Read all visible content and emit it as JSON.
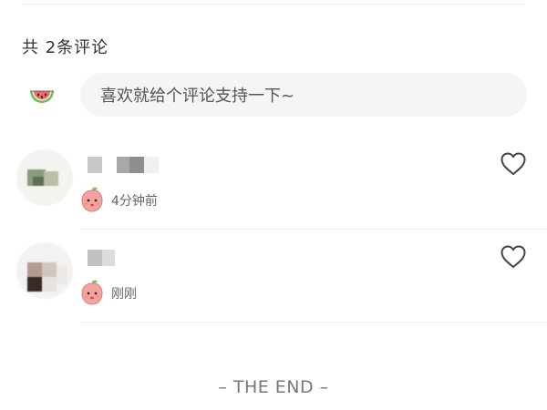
{
  "comments_header": {
    "count_text": "共 2条评论"
  },
  "input": {
    "avatar_icon": "watermelon-icon",
    "placeholder": "喜欢就给个评论支持一下~"
  },
  "comments": [
    {
      "name": "",
      "time": "4分钟前",
      "badge_icon": "peach-badge-icon",
      "like_icon": "heart-outline-icon"
    },
    {
      "name": "",
      "time": "刚刚",
      "badge_icon": "peach-badge-icon",
      "like_icon": "heart-outline-icon"
    }
  ],
  "footer": {
    "end_text": "– THE END –"
  },
  "colors": {
    "input_bg": "#f5f5f5",
    "divider": "#eeeeee",
    "text_primary": "#333333",
    "text_secondary": "#666666",
    "heart_stroke": "#444444",
    "peach": "#f4a4a0"
  }
}
